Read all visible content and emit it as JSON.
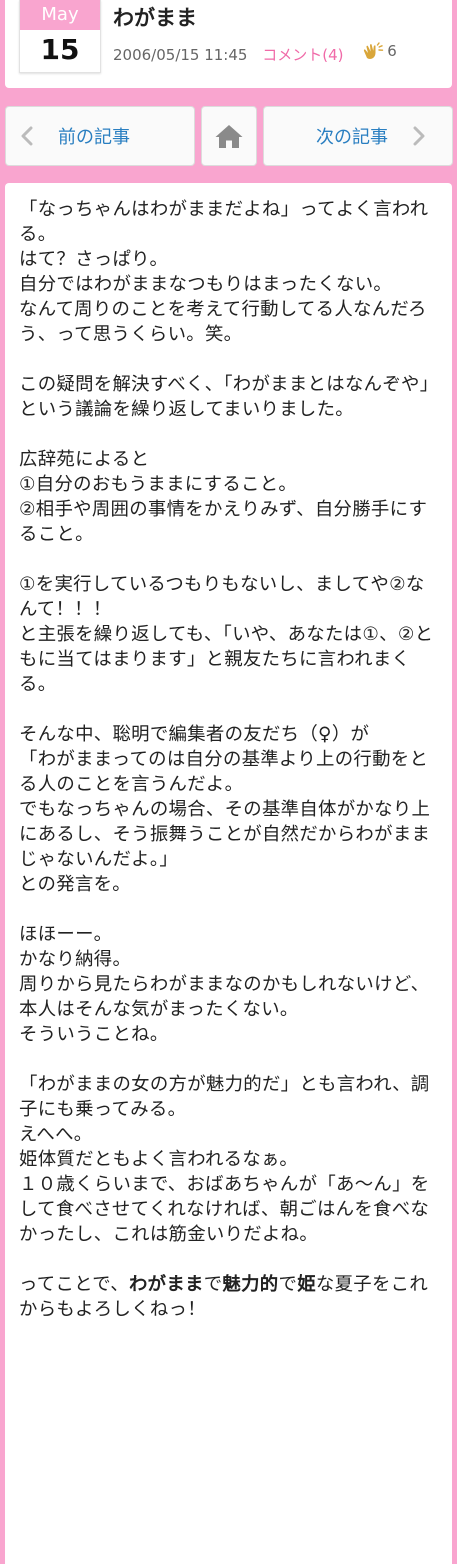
{
  "header": {
    "month": "May",
    "day": "15",
    "title": "わがまま",
    "datetime": "2006/05/15 11:45",
    "comments": "コメント(4)",
    "claps": "6",
    "clap_icon": "clap-icon"
  },
  "nav": {
    "prev_label": "前の記事",
    "next_label": "次の記事",
    "home_icon": "home-icon",
    "accent": "#2a7fc1"
  },
  "theme": {
    "background": "#f9a5cf",
    "link_pink": "#f06aa8"
  },
  "body": {
    "p1": [
      "「なっちゃんはわがままだよね」ってよく言われる。",
      "はて？さっぱり。",
      "自分ではわがままなつもりはまったくない。",
      "なんて周りのことを考えて行動してる人なんだろう、って思うくらい。笑。"
    ],
    "p2": [
      "この疑問を解決すべく、「わがままとはなんぞや」という議論を繰り返してまいりました。"
    ],
    "p3": [
      "広辞苑によると",
      "①自分のおもうままにすること。",
      "②相手や周囲の事情をかえりみず、自分勝手にすること。"
    ],
    "p4": [
      "①を実行しているつもりもないし、ましてや②なんて！！！",
      "と主張を繰り返しても、「いや、あなたは①、②ともに当てはまります」と親友たちに言われまくる。"
    ],
    "p5": [
      "そんな中、聡明で編集者の友だち（♀）が",
      "「わがままってのは自分の基準より上の行動をとる人のことを言うんだよ。",
      "でもなっちゃんの場合、その基準自体がかなり上にあるし、そう振舞うことが自然だからわがままじゃないんだよ。」",
      "との発言を。"
    ],
    "p6": [
      "ほほーー。",
      "かなり納得。",
      "周りから見たらわがままなのかもしれないけど、本人はそんな気がまったくない。",
      "そういうことね。"
    ],
    "p7": [
      "「わがままの女の方が魅力的だ」とも言われ、調子にも乗ってみる。",
      "えへへ。",
      "姫体質だともよく言われるなぁ。",
      "１０歳くらいまで、おばあちゃんが「あ～ん」をして食べさせてくれなければ、朝ごはんを食べなかったし、これは筋金いりだよね。"
    ],
    "p8": {
      "s1": "ってことで、",
      "b1": "わがまま",
      "s2": "で",
      "b2": "魅力的",
      "s3": "で",
      "b3": "姫",
      "s4": "な夏子をこれからもよろしくねっ！"
    }
  }
}
